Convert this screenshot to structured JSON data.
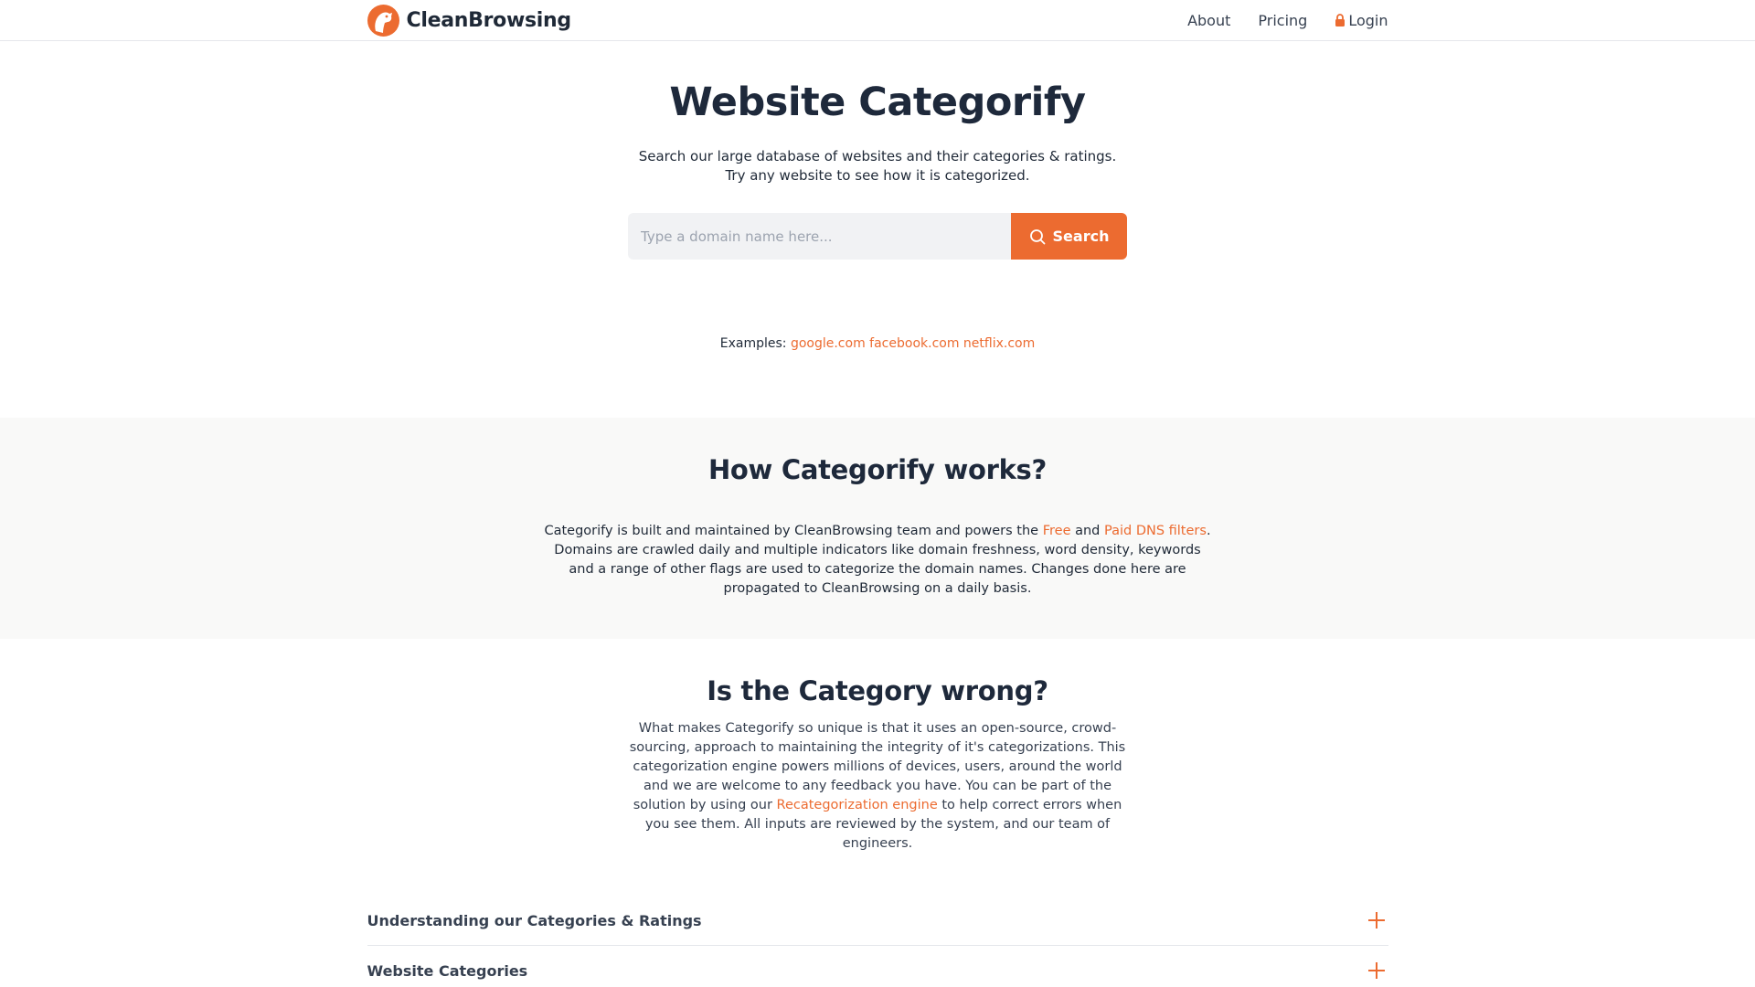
{
  "header": {
    "brand": "CleanBrowsing",
    "nav": [
      {
        "label": "About"
      },
      {
        "label": "Pricing"
      },
      {
        "label": "Login",
        "icon": "lock-icon"
      }
    ]
  },
  "hero": {
    "title": "Website Categorify",
    "subtitle_line1": "Search our large database of websites and their categories & ratings.",
    "subtitle_line2": "Try any website to see how it is categorized.",
    "search_placeholder": "Type a domain name here...",
    "search_button": "Search",
    "examples_label": "Examples:",
    "examples": [
      "google.com",
      "facebook.com",
      "netflix.com"
    ]
  },
  "how": {
    "title": "How Categorify works?",
    "text_before_free": "Categorify is built and maintained by CleanBrowsing team and powers the ",
    "free_link": "Free",
    "and_text": " and ",
    "paid_link": "Paid DNS filters",
    "text_after": ". Domains are crawled daily and multiple indicators like domain freshness, word density, keywords and a range of other flags are used to categorize the domain names. Changes done here are propagated to CleanBrowsing on a daily basis."
  },
  "wrong": {
    "title": "Is the Category wrong?",
    "text_before": "What makes Categorify so unique is that it uses an open-source, crowd-sourcing, approach to maintaining the integrity of it's categorizations. This categorization engine powers millions of devices, users, around the world and we are welcome to any feedback you have. You can be part of the solution by using our ",
    "link": "Recategorization engine",
    "text_after": " to help correct errors when you see them. All inputs are reviewed by the system, and our team of engineers."
  },
  "accordion": [
    {
      "title": "Understanding our Categories & Ratings"
    },
    {
      "title": "Website Categories"
    }
  ],
  "colors": {
    "accent": "#ec6b30",
    "heading": "#1e293b",
    "section_bg": "#f9f9f8"
  }
}
